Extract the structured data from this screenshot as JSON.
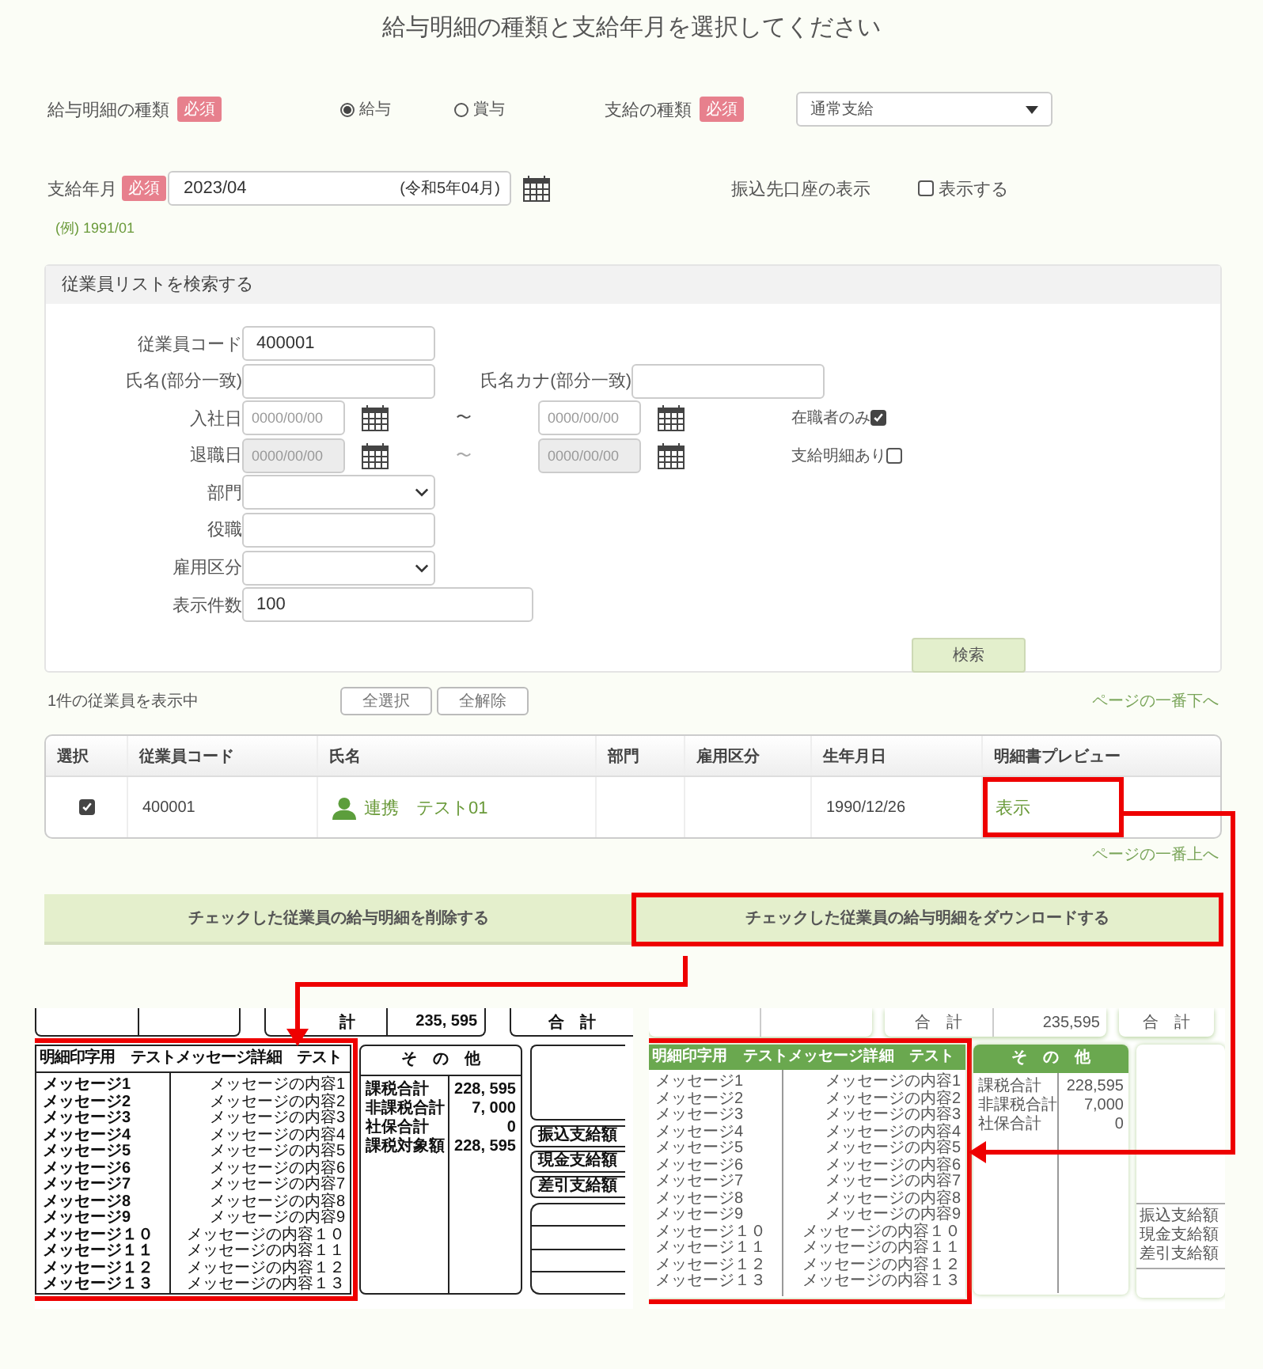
{
  "page_title": "給与明細の種類と支給年月を選択してください",
  "payslip_type": {
    "label": "給与明細の種類",
    "required_badge": "必須",
    "options": [
      {
        "label": "給与",
        "selected": true
      },
      {
        "label": "賞与",
        "selected": false
      }
    ]
  },
  "payment_type": {
    "label": "支給の種類",
    "required_badge": "必須",
    "value": "通常支給"
  },
  "payment_month": {
    "label": "支給年月",
    "required_badge": "必須",
    "value": "2023/04",
    "era_hint": "(令和5年04月)",
    "example": "(例) 1991/01"
  },
  "bank_display": {
    "label": "振込先口座の表示",
    "option": "表示する",
    "checked": false
  },
  "search_panel": {
    "title": "従業員リストを検索する",
    "rows": [
      {
        "kind": "text",
        "label": "従業員コード",
        "value": "400001"
      },
      {
        "kind": "text-pair",
        "label": "氏名(部分一致)",
        "second_label": "氏名カナ(部分一致)"
      },
      {
        "kind": "date-range",
        "label": "入社日",
        "from_placeholder": "0000/00/00",
        "separator": "〜",
        "to_placeholder": "0000/00/00",
        "disabled": false,
        "option": "在職者のみ",
        "checked": true
      },
      {
        "kind": "date-range",
        "label": "退職日",
        "from_placeholder": "0000/00/00",
        "separator": "〜",
        "to_placeholder": "0000/00/00",
        "disabled": true,
        "option": "支給明細あり",
        "checked": false
      },
      {
        "kind": "select",
        "label": "部門"
      },
      {
        "kind": "text",
        "label": "役職"
      },
      {
        "kind": "select",
        "label": "雇用区分"
      },
      {
        "kind": "long-text",
        "label": "表示件数",
        "value": "100"
      }
    ],
    "search_button": "検索"
  },
  "results": {
    "count_text": "1件の従業員を表示中",
    "buttons": [
      "全選択",
      "全解除"
    ],
    "jump_bottom": "ページの一番下へ",
    "jump_top": "ページの一番上へ"
  },
  "table": {
    "columns": [
      "選択",
      "従業員コード",
      "氏名",
      "部門",
      "雇用区分",
      "生年月日",
      "明細書プレビュー"
    ],
    "rows": [
      {
        "selected": true,
        "code": "400001",
        "name": "連携　テスト01",
        "birth_date": "1990/12/26",
        "preview": "表示",
        "preview_highlighted": true
      }
    ]
  },
  "actions": [
    {
      "label": "チェックした従業員の給与明細を削除する",
      "highlighted": false
    },
    {
      "label": "チェックした従業員の給与明細をダウンロードする",
      "highlighted": true
    }
  ],
  "previews": [
    {
      "kind": "print",
      "highlighted": true,
      "total_label": "計",
      "total_value": "235, 595",
      "sum_label": "合　計",
      "message_title": "明細印字用　テストメッセージ詳細　テスト",
      "messages": [
        {
          "label": "メッセージ1",
          "content": "メッセージの内容1"
        },
        {
          "label": "メッセージ2",
          "content": "メッセージの内容2"
        },
        {
          "label": "メッセージ3",
          "content": "メッセージの内容3"
        },
        {
          "label": "メッセージ4",
          "content": "メッセージの内容4"
        },
        {
          "label": "メッセージ5",
          "content": "メッセージの内容5"
        },
        {
          "label": "メッセージ6",
          "content": "メッセージの内容6"
        },
        {
          "label": "メッセージ7",
          "content": "メッセージの内容7"
        },
        {
          "label": "メッセージ8",
          "content": "メッセージの内容8"
        },
        {
          "label": "メッセージ9",
          "content": "メッセージの内容9"
        },
        {
          "label": "メッセージ１０",
          "content": "メッセージの内容１０"
        },
        {
          "label": "メッセージ１１",
          "content": "メッセージの内容１１"
        },
        {
          "label": "メッセージ１２",
          "content": "メッセージの内容１２"
        },
        {
          "label": "メッセージ１３",
          "content": "メッセージの内容１３"
        }
      ],
      "other_title": "そ　の　他",
      "other_rows": [
        {
          "label": "課税合計",
          "value": "228, 595"
        },
        {
          "label": "非課税合計",
          "value": "7, 000"
        },
        {
          "label": "社保合計",
          "value": "0"
        },
        {
          "label": "課税対象額",
          "value": "228, 595"
        }
      ],
      "payout_labels": [
        "振込支給額",
        "現金支給額",
        "差引支給額"
      ]
    },
    {
      "kind": "web",
      "highlighted": true,
      "total_label": "合　計",
      "total_value": "235,595",
      "sum_label": "合　計",
      "message_title": "明細印字用　テストメッセージ詳細　テスト",
      "messages": [
        {
          "label": "メッセージ1",
          "content": "メッセージの内容1"
        },
        {
          "label": "メッセージ2",
          "content": "メッセージの内容2"
        },
        {
          "label": "メッセージ3",
          "content": "メッセージの内容3"
        },
        {
          "label": "メッセージ4",
          "content": "メッセージの内容4"
        },
        {
          "label": "メッセージ5",
          "content": "メッセージの内容5"
        },
        {
          "label": "メッセージ6",
          "content": "メッセージの内容6"
        },
        {
          "label": "メッセージ7",
          "content": "メッセージの内容7"
        },
        {
          "label": "メッセージ8",
          "content": "メッセージの内容8"
        },
        {
          "label": "メッセージ9",
          "content": "メッセージの内容9"
        },
        {
          "label": "メッセージ１０",
          "content": "メッセージの内容１０"
        },
        {
          "label": "メッセージ１１",
          "content": "メッセージの内容１１"
        },
        {
          "label": "メッセージ１２",
          "content": "メッセージの内容１２"
        },
        {
          "label": "メッセージ１３",
          "content": "メッセージの内容１３"
        }
      ],
      "other_title": "そ　の　他",
      "other_rows": [
        {
          "label": "課税合計",
          "value": "228,595"
        },
        {
          "label": "非課税合計",
          "value": "7,000"
        },
        {
          "label": "社保合計",
          "value": "0"
        }
      ],
      "payout_labels": [
        "振込支給額",
        "現金支給額",
        "差引支給額"
      ]
    }
  ]
}
